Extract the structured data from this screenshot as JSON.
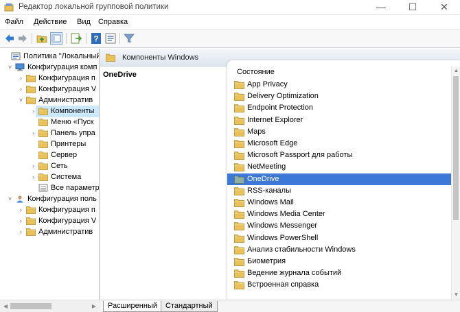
{
  "window": {
    "title": "Редактор локальной групповой политики",
    "minimize_glyph": "—",
    "maximize_glyph": "☐",
    "close_glyph": "✕"
  },
  "menu": [
    "Файл",
    "Действие",
    "Вид",
    "Справка"
  ],
  "toolbar": {
    "icons": [
      "back-arrow-icon",
      "forward-arrow-icon",
      "up-folder-icon",
      "show-hide-tree-icon",
      "export-list-icon",
      "help-icon",
      "properties-icon",
      "filter-icon"
    ]
  },
  "tree": {
    "items": [
      {
        "label": "Политика \"Локальный",
        "level": 0,
        "expander": "",
        "icon": "policy-icon"
      },
      {
        "label": "Конфигурация комп",
        "level": 1,
        "expander": "˅",
        "icon": "computer-icon"
      },
      {
        "label": "Конфигурация п",
        "level": 2,
        "expander": "›",
        "icon": "folder-icon"
      },
      {
        "label": "Конфигурация V",
        "level": 2,
        "expander": "›",
        "icon": "folder-icon"
      },
      {
        "label": "Административ",
        "level": 2,
        "expander": "˅",
        "icon": "folder-icon"
      },
      {
        "label": "Компоненты",
        "level": 3,
        "expander": "›",
        "icon": "folder-icon",
        "selected": true
      },
      {
        "label": "Меню «Пуск",
        "level": 3,
        "expander": "",
        "icon": "folder-icon"
      },
      {
        "label": "Панель упра",
        "level": 3,
        "expander": "›",
        "icon": "folder-icon"
      },
      {
        "label": "Принтеры",
        "level": 3,
        "expander": "",
        "icon": "folder-icon"
      },
      {
        "label": "Сервер",
        "level": 3,
        "expander": "",
        "icon": "folder-icon"
      },
      {
        "label": "Сеть",
        "level": 3,
        "expander": "›",
        "icon": "folder-icon"
      },
      {
        "label": "Система",
        "level": 3,
        "expander": "›",
        "icon": "folder-icon"
      },
      {
        "label": "Все параметр",
        "level": 3,
        "expander": "",
        "icon": "settings-list-icon"
      },
      {
        "label": "Конфигурация поль",
        "level": 1,
        "expander": "˅",
        "icon": "user-icon"
      },
      {
        "label": "Конфигурация п",
        "level": 2,
        "expander": "›",
        "icon": "folder-icon"
      },
      {
        "label": "Конфигурация V",
        "level": 2,
        "expander": "›",
        "icon": "folder-icon"
      },
      {
        "label": "Административ",
        "level": 2,
        "expander": "›",
        "icon": "folder-icon"
      }
    ]
  },
  "breadcrumb": "Компоненты Windows",
  "description_title": "OneDrive",
  "list": {
    "column_header": "Состояние",
    "items": [
      "App Privacy",
      "Delivery Optimization",
      "Endpoint Protection",
      "Internet Explorer",
      "Maps",
      "Microsoft Edge",
      "Microsoft Passport для работы",
      "NetMeeting",
      "OneDrive",
      "RSS-каналы",
      "Windows Mail",
      "Windows Media Center",
      "Windows Messenger",
      "Windows PowerShell",
      "Анализ стабильности Windows",
      "Биометрия",
      "Ведение журнала событий",
      "Встроенная справка"
    ],
    "selected": "OneDrive"
  },
  "tabs": [
    "Расширенный",
    "Стандартный"
  ],
  "colors": {
    "selection": "#3c78d7",
    "tree_selection": "#cce8ff",
    "folder": "#e8c15a"
  }
}
